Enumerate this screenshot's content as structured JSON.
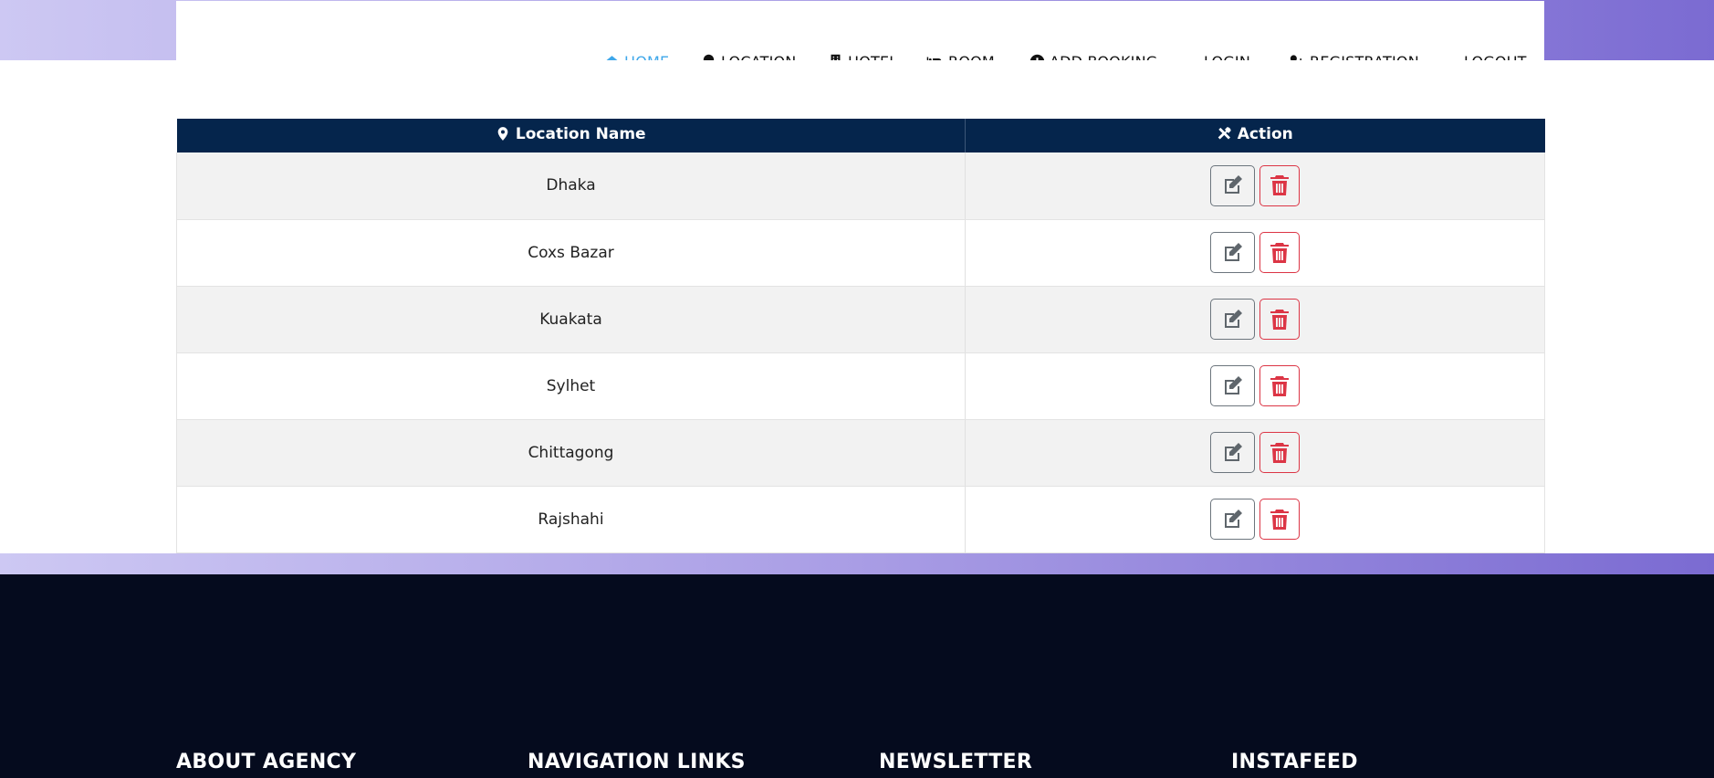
{
  "nav": {
    "items": [
      {
        "label": "HOME",
        "icon": "home-icon",
        "active": true
      },
      {
        "label": "LOCATION",
        "icon": "map-marker-icon",
        "active": false
      },
      {
        "label": "HOTEL",
        "icon": "building-icon",
        "active": false
      },
      {
        "label": "ROOM",
        "icon": "bed-icon",
        "active": false
      },
      {
        "label": "ADD BOOKING",
        "icon": "plus-circle-icon",
        "active": false
      },
      {
        "label": "LOGIN",
        "icon": "",
        "active": false
      },
      {
        "label": "REGISTRATION",
        "icon": "user-plus-icon",
        "active": false
      },
      {
        "label": "LOGOUT",
        "icon": "",
        "active": false
      }
    ],
    "active_color": "#3ea7ea"
  },
  "table": {
    "headers": {
      "location": "Location Name",
      "action": "Action"
    },
    "header_bg": "#05254c",
    "rows": [
      {
        "name": "Dhaka"
      },
      {
        "name": "Coxs Bazar"
      },
      {
        "name": "Kuakata"
      },
      {
        "name": "Sylhet"
      },
      {
        "name": "Chittagong"
      },
      {
        "name": "Rajshahi"
      }
    ]
  },
  "footer": {
    "headings": [
      "ABOUT AGENCY",
      "NAVIGATION LINKS",
      "NEWSLETTER",
      "INSTAFEED"
    ],
    "bg": "#050b1e"
  }
}
